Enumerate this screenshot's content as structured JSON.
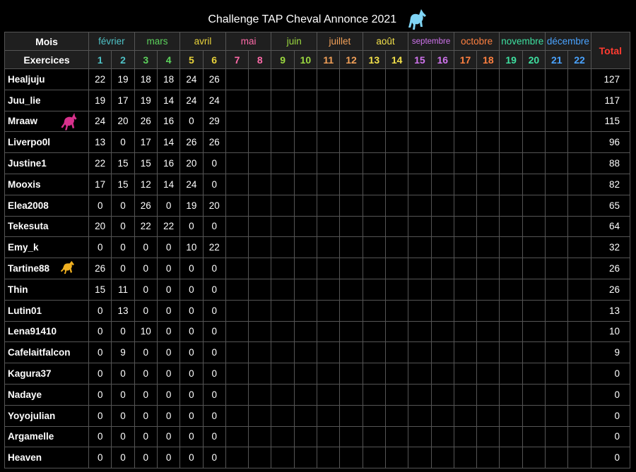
{
  "title": "Challenge TAP Cheval Annonce 2021",
  "header": {
    "mois_label": "Mois",
    "exercices_label": "Exercices",
    "total_label": "Total"
  },
  "months": [
    {
      "name": "février",
      "color": "#4fc3c7"
    },
    {
      "name": "mars",
      "color": "#5cd35c"
    },
    {
      "name": "avril",
      "color": "#e8d23a"
    },
    {
      "name": "mai",
      "color": "#ff6aa8"
    },
    {
      "name": "juin",
      "color": "#9bd83f"
    },
    {
      "name": "juillet",
      "color": "#f2a058"
    },
    {
      "name": "août",
      "color": "#f2e04a"
    },
    {
      "name": "septembre",
      "color": "#d074ee"
    },
    {
      "name": "octobre",
      "color": "#ff8040"
    },
    {
      "name": "novembre",
      "color": "#3ee0a0"
    },
    {
      "name": "décembre",
      "color": "#4aa3ff"
    }
  ],
  "exercise_numbers": [
    "1",
    "2",
    "3",
    "4",
    "5",
    "6",
    "7",
    "8",
    "9",
    "10",
    "11",
    "12",
    "13",
    "14",
    "15",
    "16",
    "17",
    "18",
    "19",
    "20",
    "21",
    "22"
  ],
  "rows": [
    {
      "name": "Healjuju",
      "scores": [
        "22",
        "19",
        "18",
        "18",
        "24",
        "26"
      ],
      "total": "127"
    },
    {
      "name": "Juu_lie",
      "scores": [
        "19",
        "17",
        "19",
        "14",
        "24",
        "24"
      ],
      "total": "117"
    },
    {
      "name": "Mraaw",
      "scores": [
        "24",
        "20",
        "26",
        "16",
        "0",
        "29"
      ],
      "total": "115",
      "badge": "pink-unicorn-icon"
    },
    {
      "name": "Liverpo0l",
      "scores": [
        "13",
        "0",
        "17",
        "14",
        "26",
        "26"
      ],
      "total": "96"
    },
    {
      "name": "Justine1",
      "scores": [
        "22",
        "15",
        "15",
        "16",
        "20",
        "0"
      ],
      "total": "88"
    },
    {
      "name": "Mooxis",
      "scores": [
        "17",
        "15",
        "12",
        "14",
        "24",
        "0"
      ],
      "total": "82"
    },
    {
      "name": "Elea2008",
      "scores": [
        "0",
        "0",
        "26",
        "0",
        "19",
        "20"
      ],
      "total": "65"
    },
    {
      "name": "Tekesuta",
      "scores": [
        "20",
        "0",
        "22",
        "22",
        "0",
        "0"
      ],
      "total": "64"
    },
    {
      "name": "Emy_k",
      "scores": [
        "0",
        "0",
        "0",
        "0",
        "10",
        "22"
      ],
      "total": "32"
    },
    {
      "name": "Tartine88",
      "scores": [
        "26",
        "0",
        "0",
        "0",
        "0",
        "0"
      ],
      "total": "26",
      "badge": "gold-horse-icon"
    },
    {
      "name": "Thin",
      "scores": [
        "15",
        "11",
        "0",
        "0",
        "0",
        "0"
      ],
      "total": "26"
    },
    {
      "name": "Lutin01",
      "scores": [
        "0",
        "13",
        "0",
        "0",
        "0",
        "0"
      ],
      "total": "13"
    },
    {
      "name": "Lena91410",
      "scores": [
        "0",
        "0",
        "10",
        "0",
        "0",
        "0"
      ],
      "total": "10"
    },
    {
      "name": "Cafelaitfalcon",
      "scores": [
        "0",
        "9",
        "0",
        "0",
        "0",
        "0"
      ],
      "total": "9"
    },
    {
      "name": "Kagura37",
      "scores": [
        "0",
        "0",
        "0",
        "0",
        "0",
        "0"
      ],
      "total": "0"
    },
    {
      "name": "Nadaye",
      "scores": [
        "0",
        "0",
        "0",
        "0",
        "0",
        "0"
      ],
      "total": "0"
    },
    {
      "name": "Yoyojulian",
      "scores": [
        "0",
        "0",
        "0",
        "0",
        "0",
        "0"
      ],
      "total": "0"
    },
    {
      "name": "Argamelle",
      "scores": [
        "0",
        "0",
        "0",
        "0",
        "0",
        "0"
      ],
      "total": "0"
    },
    {
      "name": "Heaven",
      "scores": [
        "0",
        "0",
        "0",
        "0",
        "0",
        "0"
      ],
      "total": "0"
    }
  ],
  "colors": {
    "total_header": "#ff3b30",
    "title_unicorn": "#7fd4f5",
    "pink_unicorn": "#d8308c",
    "gold_horse": "#f0b020"
  }
}
